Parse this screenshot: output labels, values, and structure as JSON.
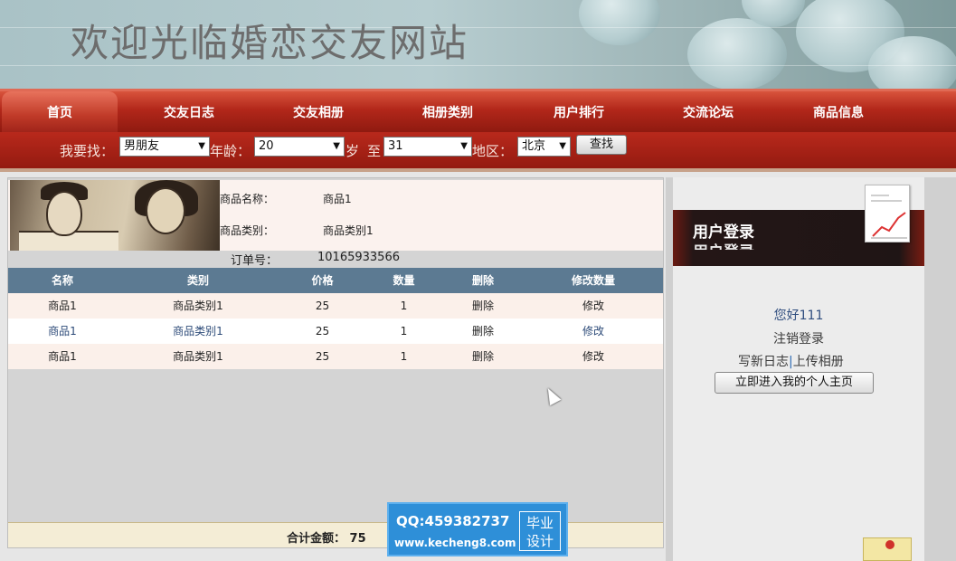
{
  "site": {
    "title": "欢迎光临婚恋交友网站"
  },
  "nav": {
    "items": [
      {
        "label": "首页",
        "active": true
      },
      {
        "label": "交友日志"
      },
      {
        "label": "交友相册"
      },
      {
        "label": "相册类别"
      },
      {
        "label": "用户排行"
      },
      {
        "label": "交流论坛"
      },
      {
        "label": "商品信息"
      }
    ]
  },
  "search": {
    "find_label": "我要找：",
    "find_value": "男朋友",
    "age_label": "年龄：",
    "age_from": "20",
    "age_unit": "岁",
    "to_label": "至",
    "age_to": "31",
    "area_label": "地区：",
    "area_value": "北京",
    "button": "查找"
  },
  "product": {
    "name_label": "商品名称：",
    "name_value": "商品1",
    "category_label": "商品类别：",
    "category_value": "商品类别1"
  },
  "order": {
    "label": "订单号：",
    "number": "10165933566"
  },
  "table": {
    "headers": [
      "名称",
      "类别",
      "价格",
      "数量",
      "删除",
      "修改数量"
    ],
    "rows": [
      [
        "商品1",
        "商品类别1",
        "25",
        "1",
        "删除",
        "修改"
      ],
      [
        "商品1",
        "商品类别1",
        "25",
        "1",
        "删除",
        "修改"
      ],
      [
        "商品1",
        "商品类别1",
        "25",
        "1",
        "删除",
        "修改"
      ]
    ]
  },
  "total": {
    "text": "合计金额： 75"
  },
  "sidebar": {
    "title": "用户登录",
    "greeting": "您好111",
    "logout": "注销登录",
    "write_diary": "写新日志",
    "separator": "|",
    "upload_album": "上传相册",
    "home_button": "立即进入我的个人主页"
  },
  "watermark": {
    "qq": "QQ:459382737",
    "url": "www.kecheng8.com",
    "badge_line1": "毕业",
    "badge_line2": "设计"
  }
}
